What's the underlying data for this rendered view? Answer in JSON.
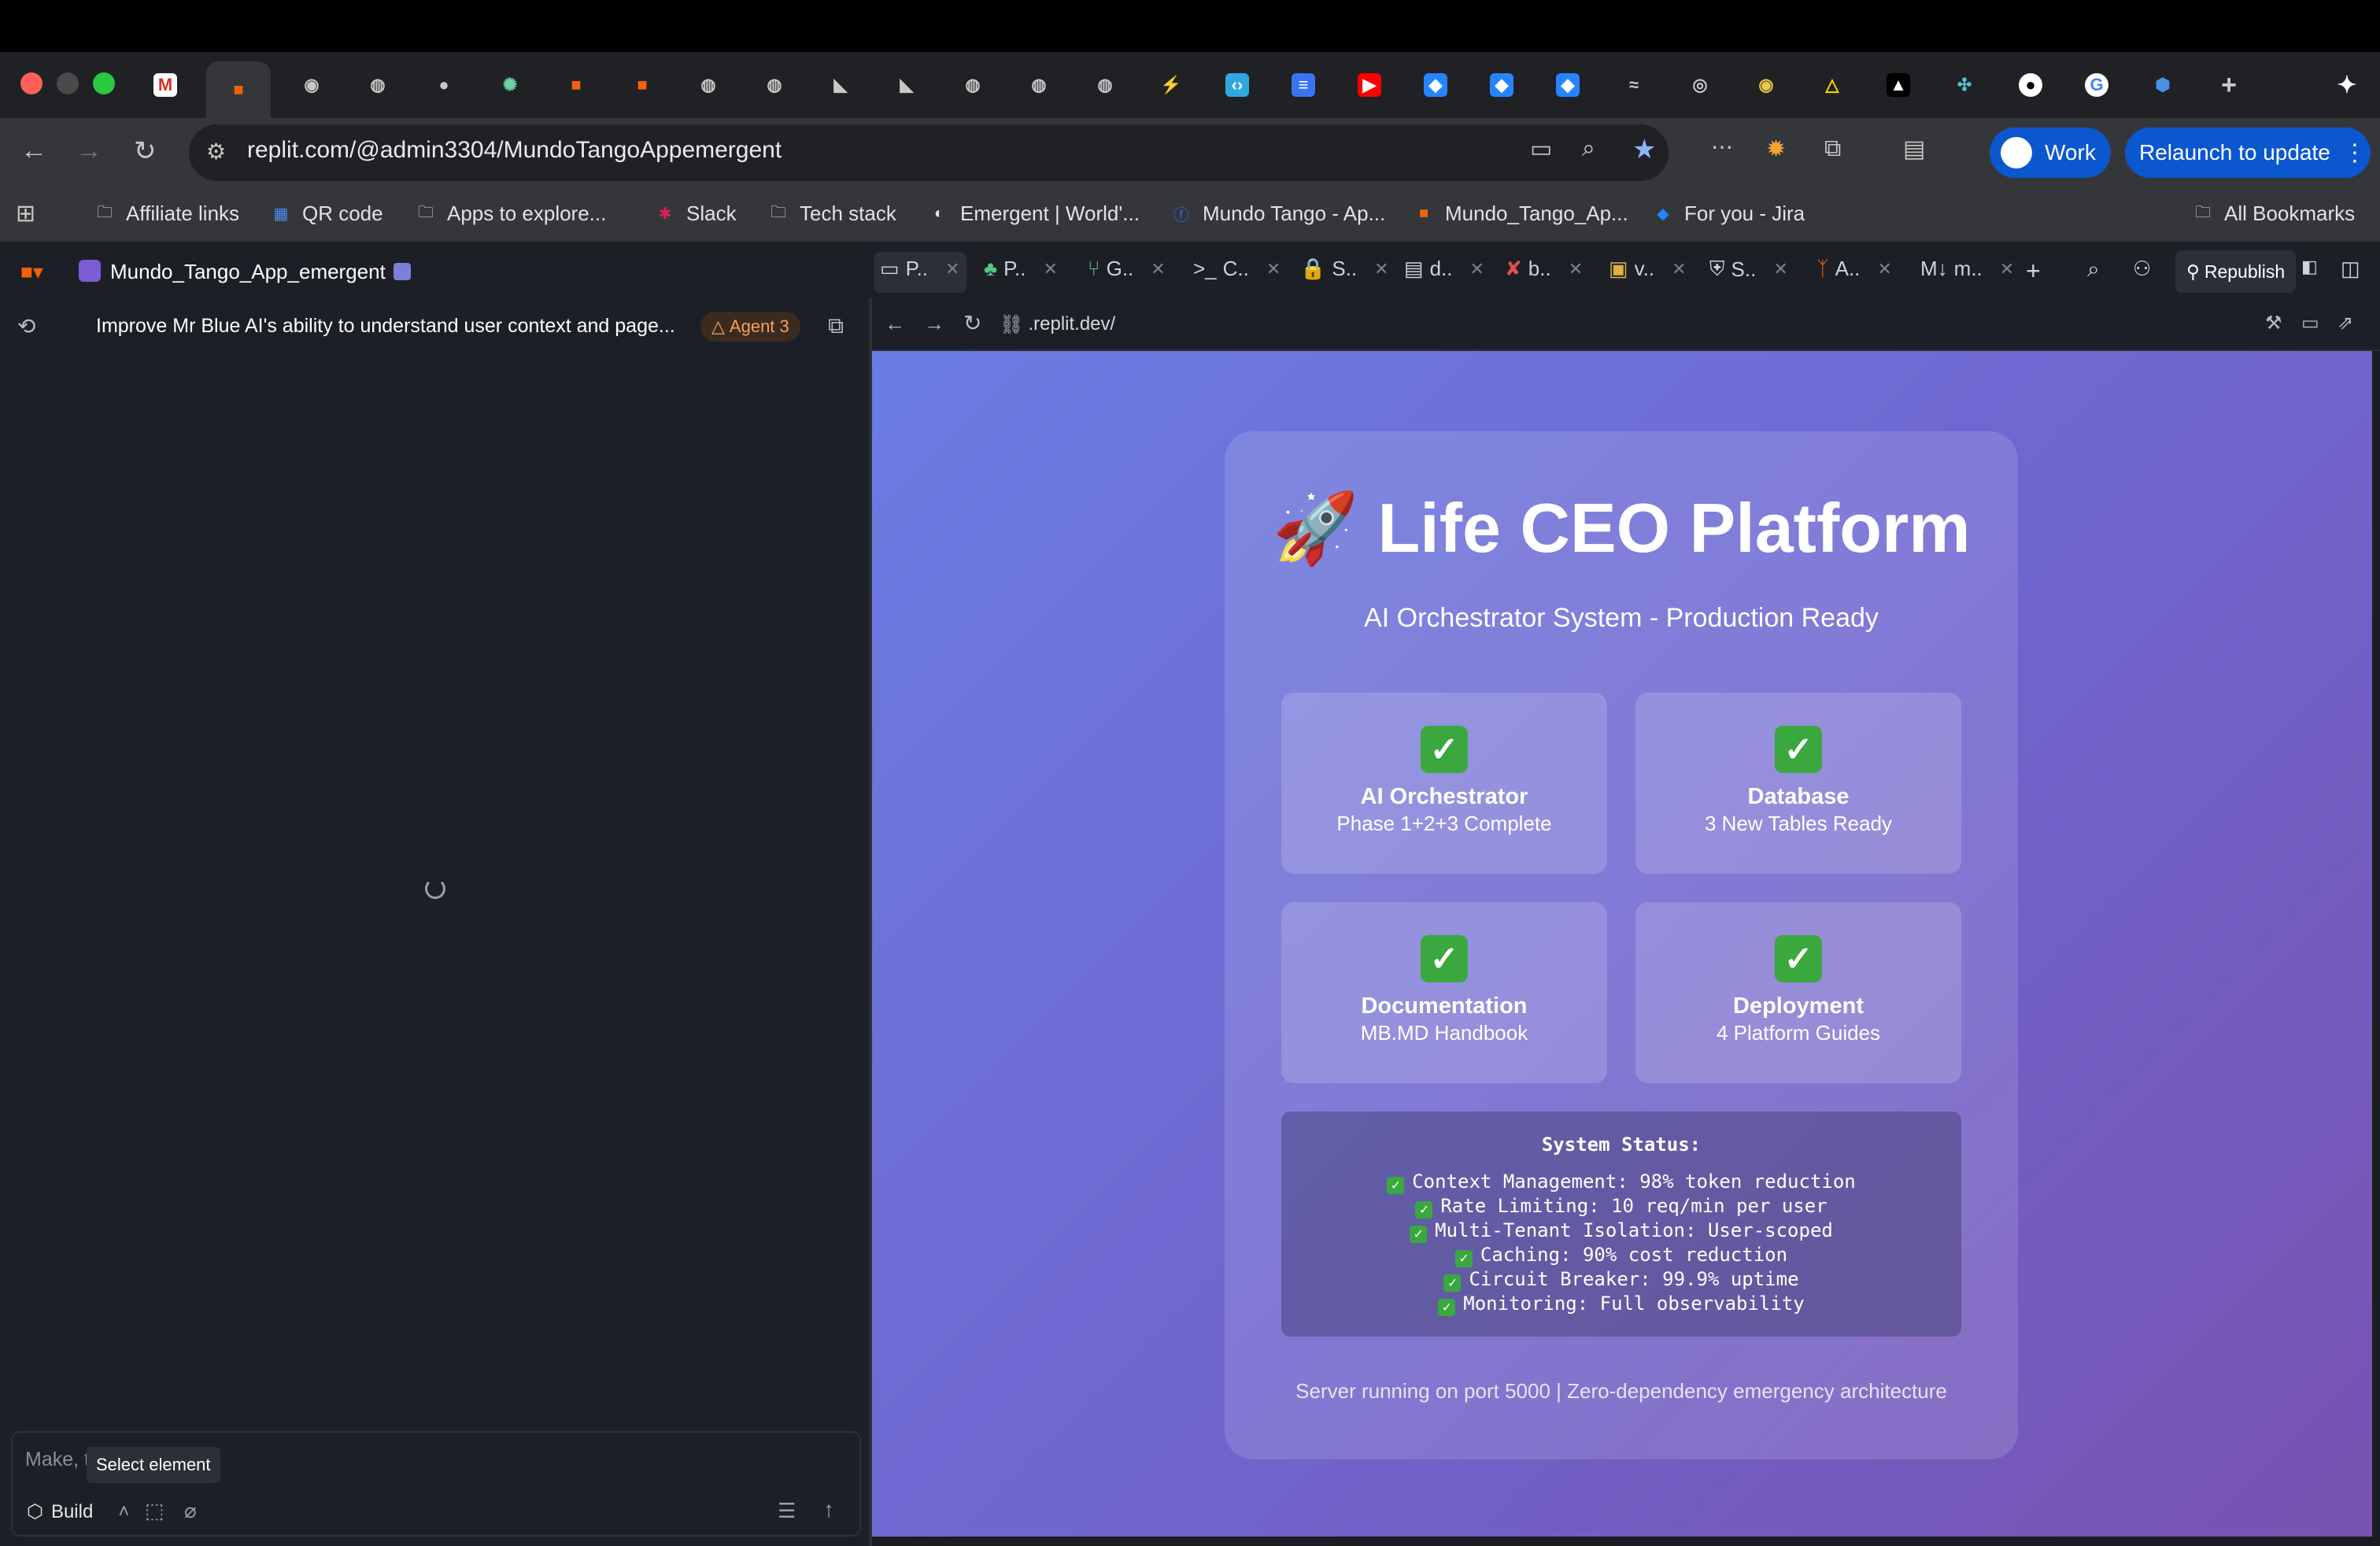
{
  "browser": {
    "url": "replit.com/@admin3304/MundoTangoAppemergent",
    "profile_label": "Work",
    "relaunch_label": "Relaunch to update"
  },
  "bookmarks": [
    {
      "label": "Affiliate links",
      "icon": "folder-icon"
    },
    {
      "label": "QR code",
      "icon": "qr-icon"
    },
    {
      "label": "Apps to explore...",
      "icon": "folder-icon"
    },
    {
      "label": "Slack",
      "icon": "slack-icon"
    },
    {
      "label": "Tech stack",
      "icon": "folder-icon"
    },
    {
      "label": "Emergent | World'...",
      "icon": "emergent-icon"
    },
    {
      "label": "Mundo Tango - Ap...",
      "icon": "facebook-icon"
    },
    {
      "label": "Mundo_Tango_Ap...",
      "icon": "replit-icon"
    },
    {
      "label": "For you - Jira",
      "icon": "jira-icon"
    },
    {
      "label": "All Bookmarks",
      "icon": "folder-icon"
    }
  ],
  "workspace": {
    "project_name": "Mundo_Tango_App_emergent",
    "chat_title": "Improve Mr Blue AI's ability to understand user context and page...",
    "agent_badge": "Agent 3",
    "input_placeholder": "Make, t",
    "tooltip": "Select element",
    "build_label": "Build",
    "republish_label": "Republish",
    "preview_url": ".replit.dev/"
  },
  "pane_tabs": [
    "P..",
    "P..",
    "G..",
    "C..",
    "S..",
    "d..",
    "b..",
    "v..",
    "S..",
    "A..",
    "m.."
  ],
  "app": {
    "title": "🚀 Life CEO Platform",
    "subtitle": "AI Orchestrator System - Production Ready",
    "features": [
      {
        "title": "AI Orchestrator",
        "subtitle": "Phase 1+2+3 Complete"
      },
      {
        "title": "Database",
        "subtitle": "3 New Tables Ready"
      },
      {
        "title": "Documentation",
        "subtitle": "MB.MD Handbook"
      },
      {
        "title": "Deployment",
        "subtitle": "4 Platform Guides"
      }
    ],
    "status_title": "System Status:",
    "status_lines": [
      "Context Management: 98% token reduction",
      "Rate Limiting: 10 req/min per user",
      "Multi-Tenant Isolation: User-scoped",
      "Caching: 90% cost reduction",
      "Circuit Breaker: 99.9% uptime",
      "Monitoring: Full observability"
    ],
    "footer": "Server running on port 5000 | Zero-dependency emergency architecture"
  },
  "colors": {
    "accent": "#0b57d0",
    "gradient_start": "#6b7de3",
    "gradient_end": "#7852b0",
    "check_green": "#3aa83e"
  }
}
